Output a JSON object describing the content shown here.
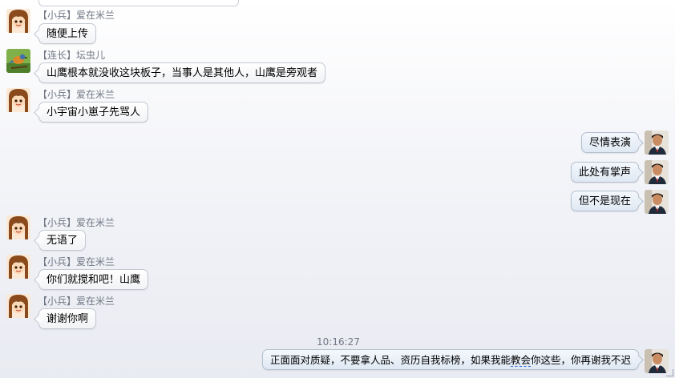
{
  "messages": [
    {
      "side": "left",
      "avatar": "girl-avatar-icon",
      "rank": "【小兵】",
      "name": "爱在米兰",
      "text": "随便上传"
    },
    {
      "side": "left",
      "avatar": "bird-avatar-icon",
      "rank": "【连长】",
      "name": "坛虫儿",
      "text": "山鹰根本就没收这块板子，当事人是其他人，山鹰是旁观者"
    },
    {
      "side": "left",
      "avatar": "girl-avatar-icon",
      "rank": "【小兵】",
      "name": "爱在米兰",
      "text": "小宇宙小崽子先骂人"
    },
    {
      "side": "right",
      "avatar": "man-avatar-icon",
      "text": "尽情表演"
    },
    {
      "side": "right",
      "avatar": "man-avatar-icon",
      "text": "此处有掌声"
    },
    {
      "side": "right",
      "avatar": "man-avatar-icon",
      "text": "但不是现在"
    },
    {
      "side": "left",
      "avatar": "girl-avatar-icon",
      "rank": "【小兵】",
      "name": "爱在米兰",
      "text": "无语了"
    },
    {
      "side": "left",
      "avatar": "girl-avatar-icon",
      "rank": "【小兵】",
      "name": "爱在米兰",
      "text": "你们就搅和吧！山鹰"
    },
    {
      "side": "left",
      "avatar": "girl-avatar-icon",
      "rank": "【小兵】",
      "name": "爱在米兰",
      "text": "谢谢你啊"
    }
  ],
  "timestamp": "10:16:27",
  "last_message": {
    "avatar": "man-avatar-icon",
    "before": "正面面对质疑，不要拿人品、资历自我标榜，如果我能",
    "underlined": "教会",
    "after": "你这些，你再谢我不迟"
  }
}
